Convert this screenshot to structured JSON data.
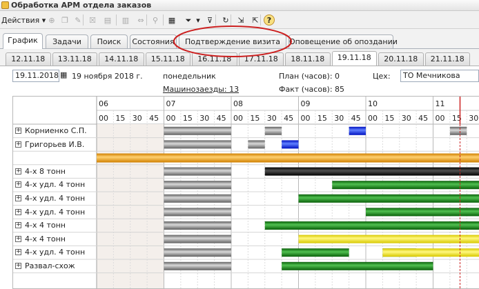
{
  "window": {
    "title": "Обработка  АРМ отдела заказов"
  },
  "toolbar": {
    "actions_label": "Действия",
    "actions_arrow": "▾",
    "buttons": [
      {
        "icon": "add-icon",
        "glyph": "⊕"
      },
      {
        "icon": "copy-icon",
        "glyph": "❐"
      },
      {
        "icon": "edit-icon",
        "glyph": "✎"
      },
      {
        "icon": "delete-icon",
        "glyph": "☒"
      },
      {
        "icon": "post-icon",
        "glyph": "▤"
      },
      {
        "icon": "unpost-icon",
        "glyph": "▥"
      },
      {
        "icon": "goto-icon",
        "glyph": "⇔"
      },
      {
        "icon": "find-icon",
        "glyph": "⚲"
      },
      {
        "icon": "list-icon",
        "glyph": "▦"
      },
      {
        "icon": "filter-icon",
        "glyph": "⏷"
      },
      {
        "icon": "filter-dropdown-icon",
        "glyph": "▾"
      },
      {
        "icon": "filter-off-icon",
        "glyph": "⊽"
      },
      {
        "icon": "refresh-icon",
        "glyph": "↻"
      },
      {
        "icon": "import-icon",
        "glyph": "⇲"
      },
      {
        "icon": "export-icon",
        "glyph": "⇱"
      },
      {
        "icon": "help-icon",
        "glyph": "?"
      }
    ]
  },
  "tabs": [
    "График",
    "Задачи",
    "Поиск",
    "Состояния",
    "Подтверждение визита",
    "Оповещение об опоздании"
  ],
  "active_tab": "График",
  "date_tabs": [
    "12.11.18",
    "13.11.18",
    "14.11.18",
    "15.11.18",
    "16.11.18",
    "17.11.18",
    "18.11.18",
    "19.11.18",
    "20.11.18",
    "21.11.18"
  ],
  "active_date": "19.11.18",
  "header": {
    "date_value": "19.11.2018",
    "calendar_icon": "calendar-icon",
    "date_text": "19 ноября 2018 г.",
    "weekday": "понедельник",
    "machine_link": "Машинозаезды: 13",
    "plan": "План (часов): 0",
    "fact": "Факт (часов): 85",
    "shop_label": "Цех:",
    "shop_value": "ТО Мечникова"
  },
  "timeline": {
    "hours": [
      "06",
      "07",
      "08",
      "09",
      "10",
      "11"
    ],
    "minutes": [
      "00",
      "15",
      "30",
      "45"
    ]
  },
  "rows": [
    {
      "name": "Корниенко С.П.",
      "bars": [
        {
          "s": 7.0,
          "e": 8.0,
          "c": "gray"
        },
        {
          "s": 8.5,
          "e": 8.75,
          "c": "gray"
        },
        {
          "s": 9.75,
          "e": 10.0,
          "c": "blue"
        },
        {
          "s": 11.25,
          "e": 11.5,
          "c": "gray"
        }
      ]
    },
    {
      "name": "Григорьев И.В.",
      "bars": [
        {
          "s": 7.0,
          "e": 8.0,
          "c": "gray"
        },
        {
          "s": 8.25,
          "e": 8.5,
          "c": "gray"
        },
        {
          "s": 8.75,
          "e": 9.0,
          "c": "blue"
        }
      ]
    },
    {
      "name": "",
      "bars": [
        {
          "s": 6.0,
          "e": 12.0,
          "c": "orange"
        }
      ]
    },
    {
      "name": "4-х 8 тонн",
      "bars": [
        {
          "s": 7.0,
          "e": 8.0,
          "c": "gray"
        },
        {
          "s": 8.5,
          "e": 12.0,
          "c": "black"
        }
      ]
    },
    {
      "name": "4-х удл. 4 тонн",
      "bars": [
        {
          "s": 7.0,
          "e": 8.0,
          "c": "gray"
        },
        {
          "s": 9.5,
          "e": 12.0,
          "c": "green"
        }
      ]
    },
    {
      "name": "4-х удл. 4 тонн",
      "bars": [
        {
          "s": 7.0,
          "e": 8.0,
          "c": "gray"
        },
        {
          "s": 9.0,
          "e": 12.0,
          "c": "green"
        }
      ]
    },
    {
      "name": "4-х удл. 4 тонн",
      "bars": [
        {
          "s": 7.0,
          "e": 8.0,
          "c": "gray"
        },
        {
          "s": 10.0,
          "e": 12.0,
          "c": "green"
        }
      ]
    },
    {
      "name": "4-х 4 тонн",
      "bars": [
        {
          "s": 7.0,
          "e": 8.0,
          "c": "gray"
        },
        {
          "s": 8.5,
          "e": 12.0,
          "c": "green"
        }
      ]
    },
    {
      "name": "4-х 4 тонн",
      "bars": [
        {
          "s": 7.0,
          "e": 8.0,
          "c": "gray"
        },
        {
          "s": 9.0,
          "e": 12.0,
          "c": "yellow"
        }
      ]
    },
    {
      "name": "4-х удл. 4 тонн",
      "bars": [
        {
          "s": 7.0,
          "e": 8.0,
          "c": "gray"
        },
        {
          "s": 8.75,
          "e": 9.75,
          "c": "green"
        },
        {
          "s": 10.25,
          "e": 10.75,
          "c": "green"
        },
        {
          "s": 10.25,
          "e": 12.0,
          "c": "yellow"
        }
      ]
    },
    {
      "name": "Развал-схож",
      "bars": [
        {
          "s": 7.0,
          "e": 8.0,
          "c": "gray"
        },
        {
          "s": 8.75,
          "e": 11.0,
          "c": "green"
        }
      ]
    }
  ],
  "now_hour": 11.4,
  "colors": {
    "accent_red": "#cc2020",
    "tab_border": "#aab0b8",
    "blue": "#1030e0",
    "green": "#148014",
    "yellow": "#f0e000",
    "orange": "#f0a000",
    "black": "#101010",
    "gray": "#808080"
  }
}
